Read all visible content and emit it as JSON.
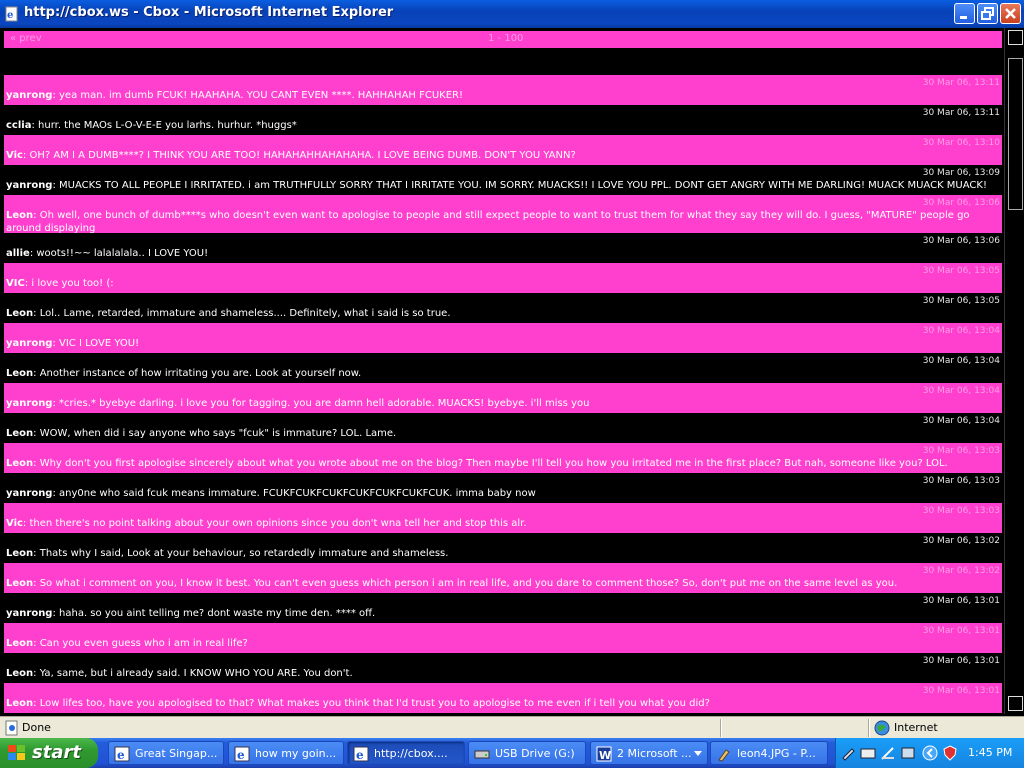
{
  "window": {
    "title": "http://cbox.ws - Cbox - Microsoft Internet Explorer",
    "app_icon": "ie-page-icon"
  },
  "nav": {
    "prev": "« prev",
    "range": "1 - 100"
  },
  "messages": [
    {
      "date": "30 Mar 06, 13:11",
      "name": "yanrong",
      "text": ": yea man. im dumb FCUK! HAAHAHA. YOU CANT EVEN ****. HAHHAHAH FCUKER!",
      "style": "pink"
    },
    {
      "date": "30 Mar 06, 13:11",
      "name": "cclia",
      "text": ": hurr. the MAOs L-O-V-E-E you larhs. hurhur. *huggs*",
      "style": "black"
    },
    {
      "date": "30 Mar 06, 13:10",
      "name": "Vic",
      "text": ": OH? AM I A DUMB****? I THINK YOU ARE TOO! HAHAHAHHAHAHAHA. I LOVE BEING DUMB. DON'T YOU YANN?",
      "style": "pink"
    },
    {
      "date": "30 Mar 06, 13:09",
      "name": "yanrong",
      "text": ": MUACKS TO ALL PEOPLE I IRRITATED. i am TRUTHFULLY SORRY THAT I IRRITATE YOU. IM SORRY. MUACKS!! I LOVE YOU PPL. DONT GET ANGRY WITH ME DARLING! MUACK MUACK MUACK!",
      "style": "black"
    },
    {
      "date": "30 Mar 06, 13:06",
      "name": "Leon",
      "text": ": Oh well, one bunch of dumb****s who doesn't even want to apologise to people and still expect people to want to trust them for what they say they will do. I guess, \"MATURE\" people go around displaying",
      "style": "pink",
      "tall": true
    },
    {
      "date": "30 Mar 06, 13:06",
      "name": "allie",
      "text": ": woots!!~~ lalalalala.. I LOVE YOU!",
      "style": "black"
    },
    {
      "date": "30 Mar 06, 13:05",
      "name": "VIC",
      "text": ": i love you too! (:",
      "style": "pink"
    },
    {
      "date": "30 Mar 06, 13:05",
      "name": "Leon",
      "text": ": Lol.. Lame, retarded, immature and shameless.... Definitely, what i said is so true.",
      "style": "black"
    },
    {
      "date": "30 Mar 06, 13:04",
      "name": "yanrong",
      "text": ": VIC I LOVE YOU!",
      "style": "pink"
    },
    {
      "date": "30 Mar 06, 13:04",
      "name": "Leon",
      "text": ": Another instance of how irritating you are. Look at yourself now.",
      "style": "black"
    },
    {
      "date": "30 Mar 06, 13:04",
      "name": "yanrong",
      "text": ": *cries.* byebye darling. i love you for tagging. you are damn hell adorable. MUACKS! byebye. i'll miss you",
      "style": "pink"
    },
    {
      "date": "30 Mar 06, 13:04",
      "name": "Leon",
      "text": ": WOW, when did i say anyone who says \"fcuk\" is immature? LOL. Lame.",
      "style": "black"
    },
    {
      "date": "30 Mar 06, 13:03",
      "name": "Leon",
      "text": ": Why don't you first apologise sincerely about what you wrote about me on the blog? Then maybe I'll tell you how you irritated me in the first place? But nah, someone like you? LOL.",
      "style": "pink"
    },
    {
      "date": "30 Mar 06, 13:03",
      "name": "yanrong",
      "text": ": any0ne who said fcuk means immature. FCUKFCUKFCUKFCUKFCUKFCUKFCUK. imma baby now",
      "style": "black"
    },
    {
      "date": "30 Mar 06, 13:03",
      "name": "Vic",
      "text": ": then there's no point talking about your own opinions since you don't wna tell her and stop this alr.",
      "style": "pink"
    },
    {
      "date": "30 Mar 06, 13:02",
      "name": "Leon",
      "text": ": Thats why I said, Look at your behaviour, so retardedly immature and shameless.",
      "style": "black"
    },
    {
      "date": "30 Mar 06, 13:02",
      "name": "Leon",
      "text": ": So what i comment on you, I know it best. You can't even guess which person i am in real life, and you dare to comment those? So, don't put me on the same level as you.",
      "style": "pink"
    },
    {
      "date": "30 Mar 06, 13:01",
      "name": "yanrong",
      "text": ": haha. so you aint telling me? dont waste my time den. **** off.",
      "style": "black"
    },
    {
      "date": "30 Mar 06, 13:01",
      "name": "Leon",
      "text": ": Can you even guess who i am in real life?",
      "style": "pink"
    },
    {
      "date": "30 Mar 06, 13:01",
      "name": "Leon",
      "text": ": Ya, same, but i already said. I KNOW WHO YOU ARE. You don't.",
      "style": "black"
    },
    {
      "date": "30 Mar 06, 13:01",
      "name": "Leon",
      "text": ": Low lifes too, have you apologised to that? What makes you think that I'd trust you to apologise to me even if i tell you what you did?",
      "style": "pink"
    }
  ],
  "status": {
    "text": "Done",
    "zone": "Internet"
  },
  "taskbar": {
    "start": "start",
    "tasks": [
      {
        "label": "Great Singap...",
        "icon": "ie-icon"
      },
      {
        "label": "how my goin...",
        "icon": "ie-icon"
      },
      {
        "label": "http://cbox....",
        "icon": "ie-icon",
        "active": true
      },
      {
        "label": "USB Drive (G:)",
        "icon": "drive-icon"
      },
      {
        "label": "2 Microsoft ...",
        "icon": "word-icon",
        "group": true
      },
      {
        "label": "leon4.JPG - P...",
        "icon": "paint-icon"
      }
    ],
    "clock": "1:45 PM"
  }
}
